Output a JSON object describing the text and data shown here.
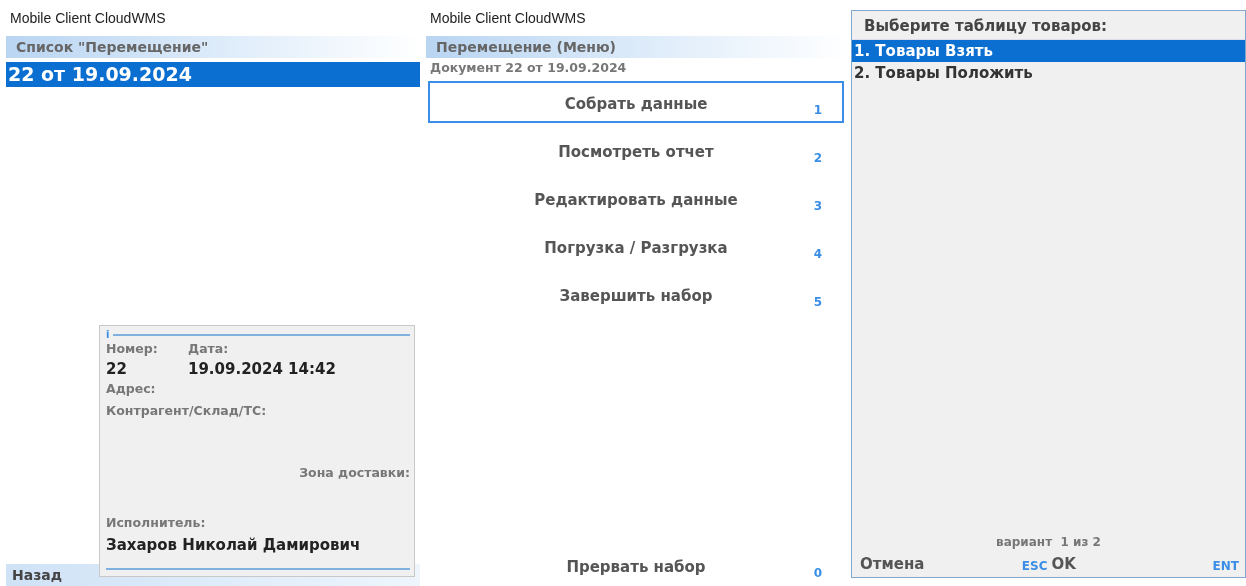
{
  "screens": [
    {
      "app_title": "Mobile Client CloudWMS",
      "header": "Список \"Перемещение\"",
      "list": [
        {
          "label": "22 от 19.09.2024",
          "selected": true
        }
      ],
      "info_popup": {
        "marker": "i",
        "number_label": "Номер:",
        "date_label": "Дата:",
        "number": "22",
        "date": "19.09.2024 14:42",
        "address_label": "Адрес:",
        "counterparty_label": "Контрагент/Склад/ТС:",
        "zone_label": "Зона доставки:",
        "executor_label": "Исполнитель:",
        "executor": "Захаров Николай Дамирович"
      },
      "footer": {
        "back": "Назад"
      }
    },
    {
      "app_title": "Mobile Client CloudWMS",
      "header": "Перемещение (Меню)",
      "subtitle": "Документ 22 от 19.09.2024",
      "menu": [
        {
          "label": "Собрать данные",
          "key": "1",
          "selected": true
        },
        {
          "label": "Посмотреть отчет",
          "key": "2",
          "selected": false
        },
        {
          "label": "Редактировать данные",
          "key": "3",
          "selected": false
        },
        {
          "label": "Погрузка / Разгрузка",
          "key": "4",
          "selected": false
        },
        {
          "label": "Завершить набор",
          "key": "5",
          "selected": false
        }
      ],
      "bottom_item": {
        "label": "Прервать набор",
        "key": "0",
        "selected": false
      }
    },
    {
      "dialog": {
        "title": "Выберите таблицу товаров:",
        "options": [
          {
            "label": "1. Товары Взять",
            "selected": true
          },
          {
            "label": "2. Товары Положить",
            "selected": false
          }
        ],
        "counter": "вариант  1 из 2",
        "buttons": [
          {
            "label": "Отмена",
            "key": "ESC"
          },
          {
            "label": "OK",
            "key": "ENT"
          }
        ]
      }
    }
  ]
}
